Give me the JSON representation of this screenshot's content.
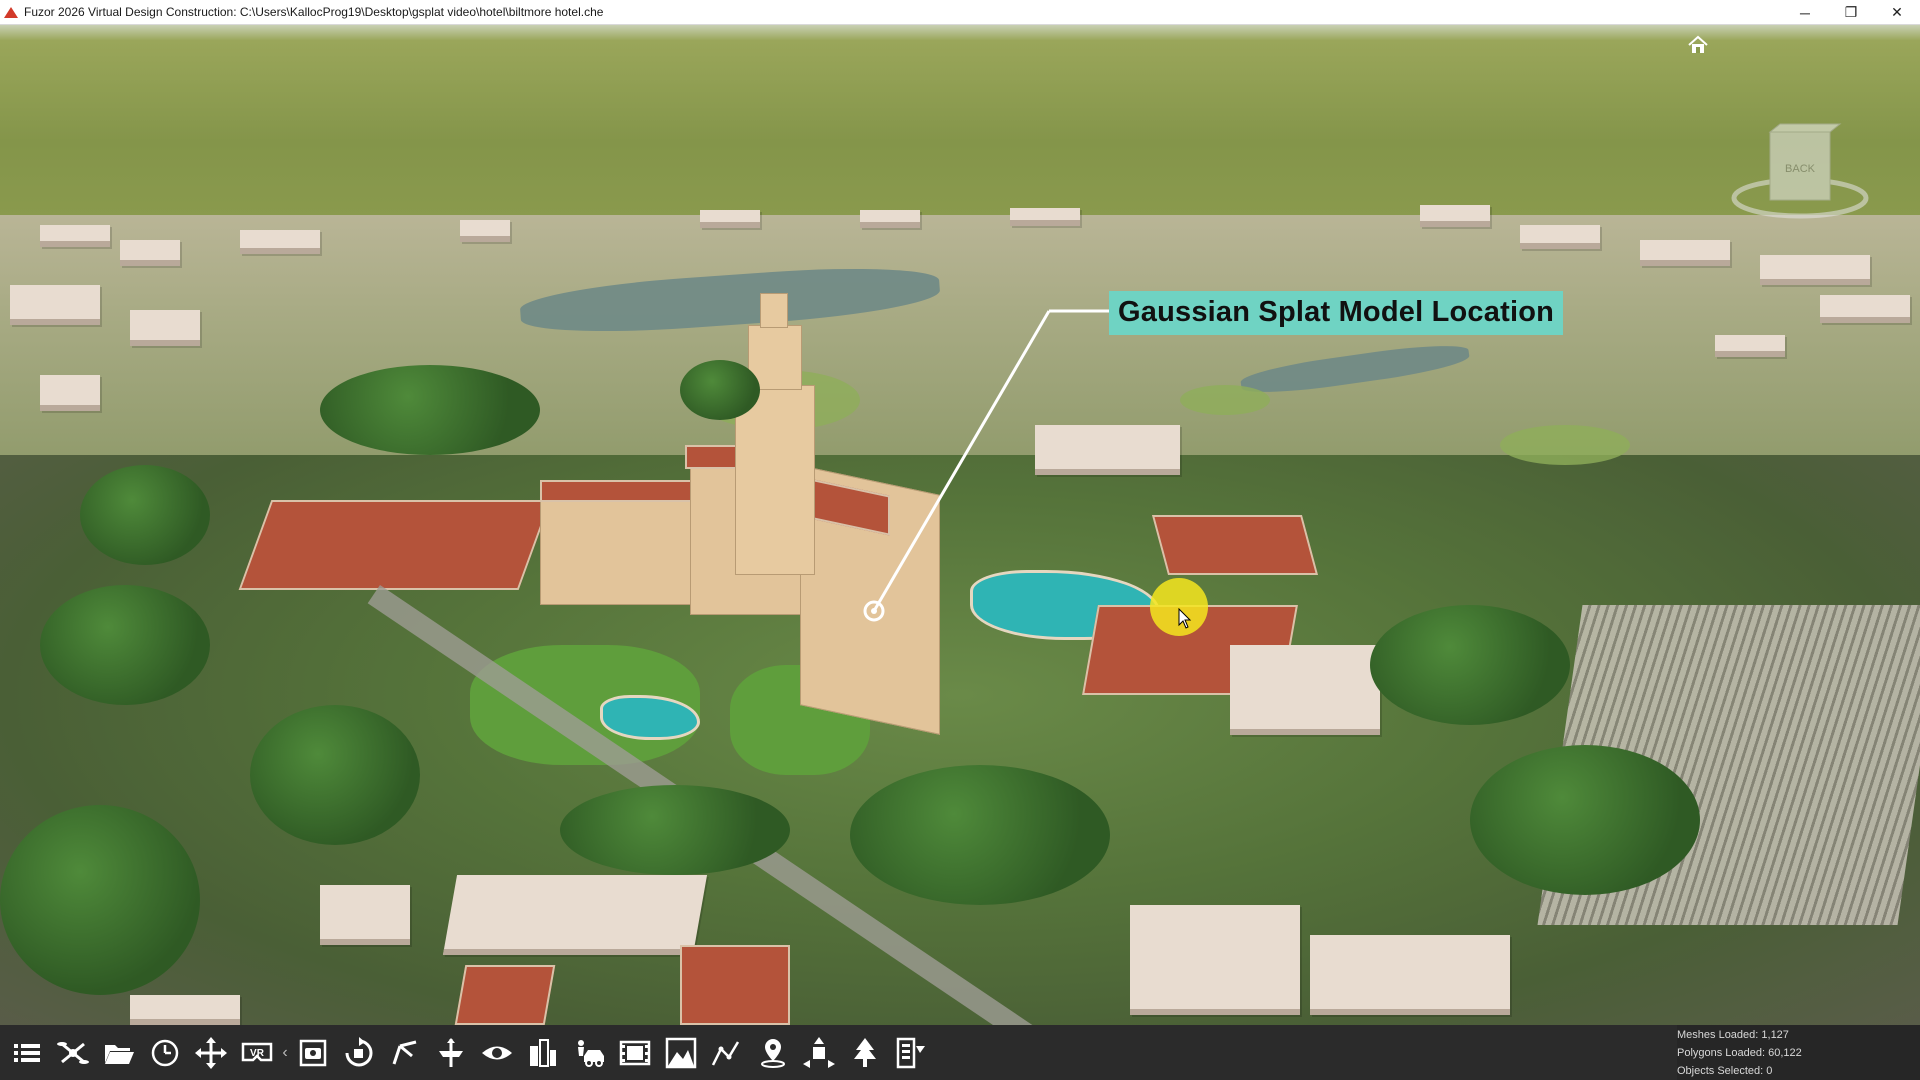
{
  "window": {
    "title": "Fuzor 2026 Virtual Design Construction: C:\\Users\\KallocProg19\\Desktop\\gsplat video\\hotel\\biltmore hotel.che",
    "controls": {
      "minimize": "─",
      "restore": "❐",
      "close": "✕"
    }
  },
  "viewport": {
    "annotation_label": "Gaussian Splat Model Location",
    "annotation_color": "#6fd3c3",
    "cursor_highlight_color": "#f5e61e",
    "nav_cube_label": "BACK"
  },
  "toolbar": {
    "tools": [
      {
        "name": "menu-icon"
      },
      {
        "name": "drone-icon"
      },
      {
        "name": "folder-open-icon"
      },
      {
        "name": "clock-icon"
      },
      {
        "name": "move-icon"
      },
      {
        "name": "vr-icon"
      },
      {
        "name": "collapse-chevron-icon"
      },
      {
        "name": "screenshot-icon"
      },
      {
        "name": "rotate-object-icon"
      },
      {
        "name": "measure-icon"
      },
      {
        "name": "section-plane-icon"
      },
      {
        "name": "eye-icon"
      },
      {
        "name": "building-icon"
      },
      {
        "name": "vehicle-worker-icon"
      },
      {
        "name": "film-icon"
      },
      {
        "name": "terrain-icon"
      },
      {
        "name": "path-graph-icon"
      },
      {
        "name": "location-pin-icon"
      },
      {
        "name": "transform-icon"
      },
      {
        "name": "tree-icon"
      },
      {
        "name": "properties-list-icon"
      }
    ],
    "vr_label": "VR"
  },
  "stats": {
    "meshes": "Meshes Loaded: 1,127",
    "polygons": "Polygons Loaded: 60,122",
    "selected": "Objects Selected: 0"
  }
}
